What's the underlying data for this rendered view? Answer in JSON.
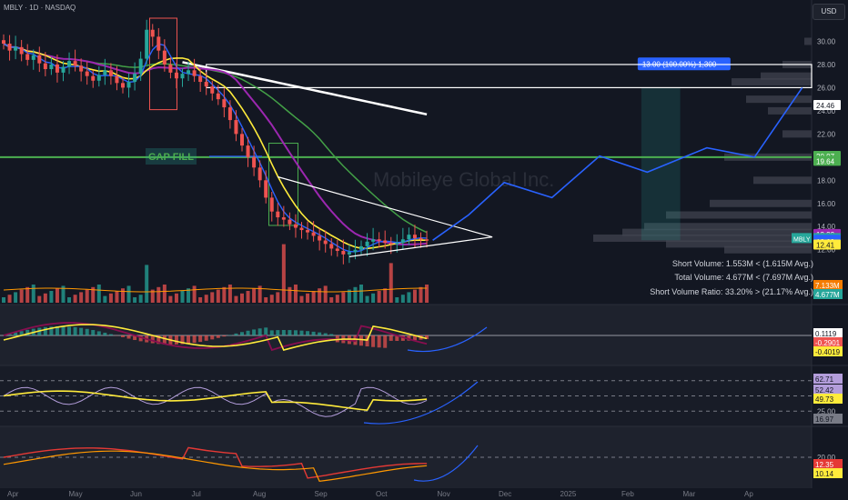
{
  "header": {
    "symbol_line": "MBLY · 1D · NASDAQ",
    "currency_button": "USD"
  },
  "annotations": {
    "gap_fill": "GAP FILL",
    "target_box": "13.00 (100.00%) 1,300",
    "watermark": "Mobileye Global Inc."
  },
  "stats": {
    "short_volume": "Short Volume: 1.553M < (1.615M Avg.)",
    "total_volume": "Total Volume: 4.677M < (7.697M Avg.)",
    "short_ratio": "Short Volume Ratio: 33.20% > (21.17% Avg.)"
  },
  "colors": {
    "background": "#131722",
    "candle_up": "#26a69a",
    "candle_down": "#ef5350",
    "accent_blue": "#2962ff",
    "yellow": "#ffeb3b",
    "purple": "#9c27b0",
    "green_ma": "#43a047",
    "green_level": "#4caf50",
    "red_ma": "#e53935"
  },
  "chart_data": [
    {
      "type": "candlestick",
      "name": "price",
      "ylim": [
        10.8,
        32
      ],
      "y_ticks": [
        "30.00",
        "28.00",
        "26.00",
        "24.00",
        "22.00",
        "20.00",
        "18.00",
        "16.00",
        "14.00",
        "12.00"
      ],
      "x_ticks": [
        "Apr",
        "May",
        "Jun",
        "Jul",
        "Aug",
        "Sep",
        "Oct",
        "Nov",
        "Dec",
        "2025",
        "Feb",
        "Mar",
        "Ap"
      ],
      "closes": [
        29.8,
        29.2,
        29.5,
        28.9,
        28.4,
        28.8,
        28.1,
        27.6,
        28.0,
        27.3,
        27.8,
        28.3,
        27.9,
        27.4,
        27.0,
        26.6,
        27.1,
        27.5,
        27.0,
        26.4,
        26.0,
        26.5,
        27.2,
        28.5,
        31.0,
        30.4,
        29.2,
        28.0,
        27.3,
        26.8,
        27.2,
        27.5,
        27.0,
        26.5,
        26.1,
        25.5,
        25.0,
        24.3,
        23.2,
        22.0,
        21.0,
        20.0,
        19.1,
        18.0,
        16.5,
        15.3,
        14.8,
        14.6,
        14.2,
        13.9,
        13.7,
        13.5,
        13.2,
        12.8,
        12.5,
        12.1,
        11.9,
        11.6,
        11.8,
        12.0,
        12.3,
        12.7,
        12.9,
        12.8,
        12.6,
        12.5,
        12.6,
        12.9,
        13.3,
        13.0,
        12.9,
        12.82
      ],
      "price_labels": [
        {
          "value": 24.46,
          "text": "24.46",
          "color": "#ffffff"
        },
        {
          "value": 20.07,
          "text": "20.07",
          "color": "#4caf50"
        },
        {
          "value": 19.64,
          "text": "19.64",
          "color": "#4caf50"
        },
        {
          "value": 13.32,
          "text": "13.32",
          "color": "#9c27b0"
        },
        {
          "value": 12.97,
          "text": "12.97",
          "color": "#26a69a",
          "tag": "MBLY"
        },
        {
          "value": 12.82,
          "text": "12.82",
          "color": "#2962ff"
        },
        {
          "value": 12.69,
          "text": "12.69",
          "color": "#2962ff"
        },
        {
          "value": 12.41,
          "text": "12.41",
          "color": "#ffeb3b"
        }
      ],
      "levels": {
        "horizontal_green": 20.0,
        "box_top": 28.0,
        "box_bottom": 26.0
      },
      "projection": [
        [
          72,
          12.82
        ],
        [
          78,
          15.0
        ],
        [
          84,
          17.8
        ],
        [
          92,
          16.5
        ],
        [
          100,
          20.1
        ],
        [
          108,
          18.7
        ],
        [
          118,
          20.8
        ],
        [
          126,
          20.0
        ],
        [
          134,
          26.0
        ]
      ],
      "target_price": 26.0
    },
    {
      "type": "bar",
      "name": "volume",
      "labels": [
        "7.133M",
        "4.677M"
      ]
    },
    {
      "type": "line",
      "name": "macd",
      "labels": [
        "0.1119",
        "-0.2901",
        "-0.4019"
      ]
    },
    {
      "type": "line",
      "name": "rsi",
      "y_ticks": [
        "75.00",
        "50.00",
        "25.00"
      ],
      "labels": [
        "62.71",
        "52.42",
        "49.73",
        "16.97"
      ]
    },
    {
      "type": "line",
      "name": "adx",
      "y_ticks": [
        "20.00"
      ],
      "labels": [
        "12.35",
        "10.14"
      ]
    }
  ]
}
